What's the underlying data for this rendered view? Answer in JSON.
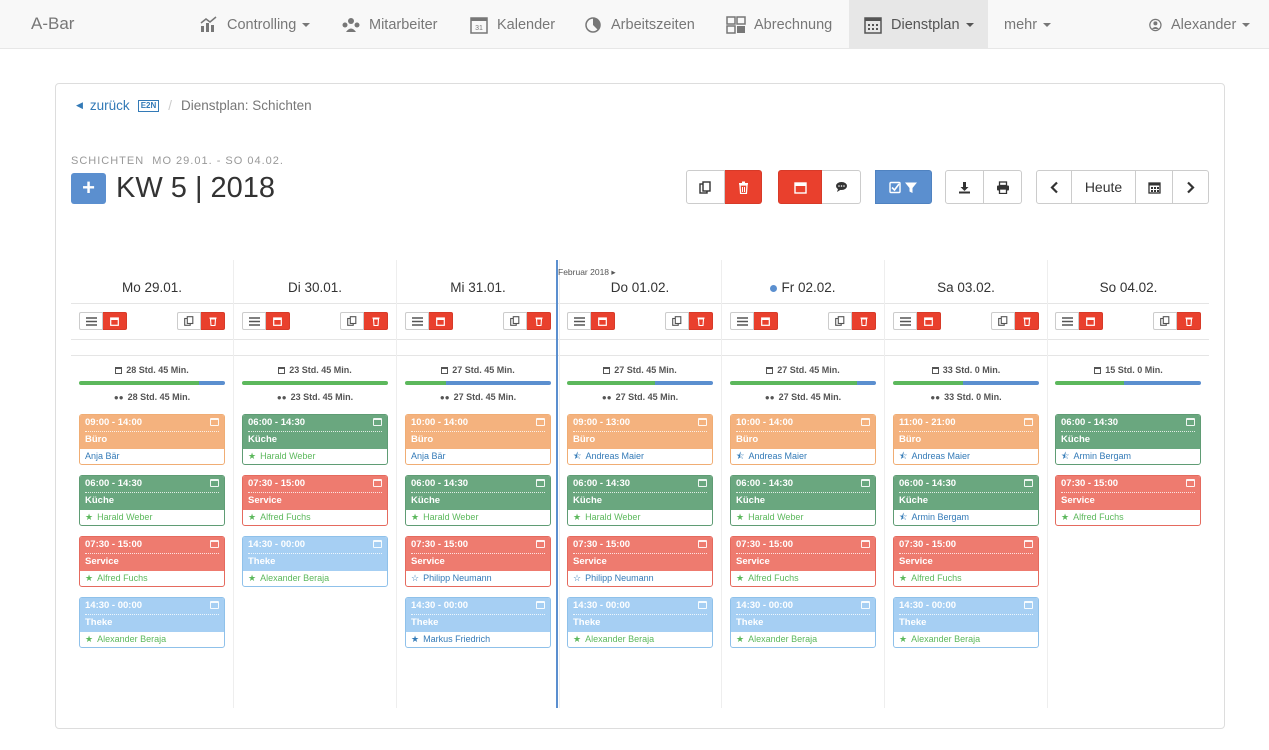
{
  "navbar": {
    "brand": "A-Bar",
    "items": [
      {
        "label": "Controlling",
        "icon": "controlling-icon",
        "dropdown": true
      },
      {
        "label": "Mitarbeiter",
        "icon": "employees-icon",
        "dropdown": false
      },
      {
        "label": "Kalender",
        "icon": "calendar-31-icon",
        "dropdown": false
      },
      {
        "label": "Arbeitszeiten",
        "icon": "clock-icon",
        "dropdown": false
      },
      {
        "label": "Abrechnung",
        "icon": "billing-icon",
        "dropdown": false
      },
      {
        "label": "Dienstplan",
        "icon": "roster-icon",
        "dropdown": true,
        "active": true
      },
      {
        "label": "mehr",
        "icon": "",
        "dropdown": true
      }
    ],
    "user": "Alexander"
  },
  "breadcrumb": {
    "back": "zurück",
    "badge": "E2N",
    "current": "Dienstplan: Schichten"
  },
  "header": {
    "subtitle": "SCHICHTEN  MO 29.01. - SO 04.02.",
    "add_label": "+",
    "title": "KW 5 | 2018",
    "today_label": "Heute"
  },
  "calendar": {
    "month_label": "Februar 2018 ▸",
    "days": [
      {
        "label": "Mo 29.01.",
        "today": false,
        "hours_planned": "28 Std. 45 Min.",
        "hours_staffed": "28 Std. 45 Min.",
        "fill_green": 0.82,
        "fill_blue": 0.18,
        "shifts": [
          {
            "time": "09:00 - 14:00",
            "area": "Büro",
            "employee": "Anja Bär",
            "color": "orange",
            "star": "none"
          },
          {
            "time": "06:00 - 14:30",
            "area": "Küche",
            "employee": "Harald Weber",
            "color": "green",
            "star": "full"
          },
          {
            "time": "07:30 - 15:00",
            "area": "Service",
            "employee": "Alfred Fuchs",
            "color": "red",
            "star": "full"
          },
          {
            "time": "14:30 - 00:00",
            "area": "Theke",
            "employee": "Alexander Beraja",
            "color": "blue",
            "star": "full"
          }
        ]
      },
      {
        "label": "Di 30.01.",
        "today": false,
        "hours_planned": "23 Std. 45 Min.",
        "hours_staffed": "23 Std. 45 Min.",
        "fill_green": 1.0,
        "fill_blue": 0.0,
        "shifts": [
          {
            "time": "06:00 - 14:30",
            "area": "Küche",
            "employee": "Harald Weber",
            "color": "green",
            "star": "full"
          },
          {
            "time": "07:30 - 15:00",
            "area": "Service",
            "employee": "Alfred Fuchs",
            "color": "red",
            "star": "full"
          },
          {
            "time": "14:30 - 00:00",
            "area": "Theke",
            "employee": "Alexander Beraja",
            "color": "blue",
            "star": "full"
          }
        ]
      },
      {
        "label": "Mi 31.01.",
        "today": false,
        "hours_planned": "27 Std. 45 Min.",
        "hours_staffed": "27 Std. 45 Min.",
        "fill_green": 0.28,
        "fill_blue": 0.72,
        "shifts": [
          {
            "time": "10:00 - 14:00",
            "area": "Büro",
            "employee": "Anja Bär",
            "color": "orange",
            "star": "none"
          },
          {
            "time": "06:00 - 14:30",
            "area": "Küche",
            "employee": "Harald Weber",
            "color": "green",
            "star": "full"
          },
          {
            "time": "07:30 - 15:00",
            "area": "Service",
            "employee": "Philipp Neumann",
            "color": "red",
            "star": "empty"
          },
          {
            "time": "14:30 - 00:00",
            "area": "Theke",
            "employee": "Markus Friedrich",
            "color": "blue",
            "star": "full-blue"
          }
        ]
      },
      {
        "label": "Do 01.02.",
        "today": false,
        "hours_planned": "27 Std. 45 Min.",
        "hours_staffed": "27 Std. 45 Min.",
        "fill_green": 0.6,
        "fill_blue": 0.4,
        "shifts": [
          {
            "time": "09:00 - 13:00",
            "area": "Büro",
            "employee": "Andreas Maier",
            "color": "orange",
            "star": "half"
          },
          {
            "time": "06:00 - 14:30",
            "area": "Küche",
            "employee": "Harald Weber",
            "color": "green",
            "star": "full"
          },
          {
            "time": "07:30 - 15:00",
            "area": "Service",
            "employee": "Philipp Neumann",
            "color": "red",
            "star": "empty"
          },
          {
            "time": "14:30 - 00:00",
            "area": "Theke",
            "employee": "Alexander Beraja",
            "color": "blue",
            "star": "full"
          }
        ]
      },
      {
        "label": "Fr 02.02.",
        "today": true,
        "hours_planned": "27 Std. 45 Min.",
        "hours_staffed": "27 Std. 45 Min.",
        "fill_green": 0.87,
        "fill_blue": 0.13,
        "shifts": [
          {
            "time": "10:00 - 14:00",
            "area": "Büro",
            "employee": "Andreas Maier",
            "color": "orange",
            "star": "half"
          },
          {
            "time": "06:00 - 14:30",
            "area": "Küche",
            "employee": "Harald Weber",
            "color": "green",
            "star": "full"
          },
          {
            "time": "07:30 - 15:00",
            "area": "Service",
            "employee": "Alfred Fuchs",
            "color": "red",
            "star": "full"
          },
          {
            "time": "14:30 - 00:00",
            "area": "Theke",
            "employee": "Alexander Beraja",
            "color": "blue",
            "star": "full"
          }
        ]
      },
      {
        "label": "Sa 03.02.",
        "today": false,
        "hours_planned": "33 Std. 0 Min.",
        "hours_staffed": "33 Std. 0 Min.",
        "fill_green": 0.48,
        "fill_blue": 0.52,
        "shifts": [
          {
            "time": "11:00 - 21:00",
            "area": "Büro",
            "employee": "Andreas Maier",
            "color": "orange",
            "star": "half"
          },
          {
            "time": "06:00 - 14:30",
            "area": "Küche",
            "employee": "Armin Bergam",
            "color": "green",
            "star": "half"
          },
          {
            "time": "07:30 - 15:00",
            "area": "Service",
            "employee": "Alfred Fuchs",
            "color": "red",
            "star": "full"
          },
          {
            "time": "14:30 - 00:00",
            "area": "Theke",
            "employee": "Alexander Beraja",
            "color": "blue",
            "star": "full"
          }
        ]
      },
      {
        "label": "So 04.02.",
        "today": false,
        "hours_planned": "15 Std. 0 Min.",
        "hours_staffed": "",
        "fill_green": 0.47,
        "fill_blue": 0.53,
        "shifts": [
          {
            "time": "06:00 - 14:30",
            "area": "Küche",
            "employee": "Armin Bergam",
            "color": "green",
            "star": "half"
          },
          {
            "time": "07:30 - 15:00",
            "area": "Service",
            "employee": "Alfred Fuchs",
            "color": "red",
            "star": "full"
          }
        ]
      }
    ]
  },
  "colors": {
    "primary": "#5b8fcf",
    "danger": "#e9402d",
    "success": "#5cb85c",
    "link": "#337ab7"
  }
}
